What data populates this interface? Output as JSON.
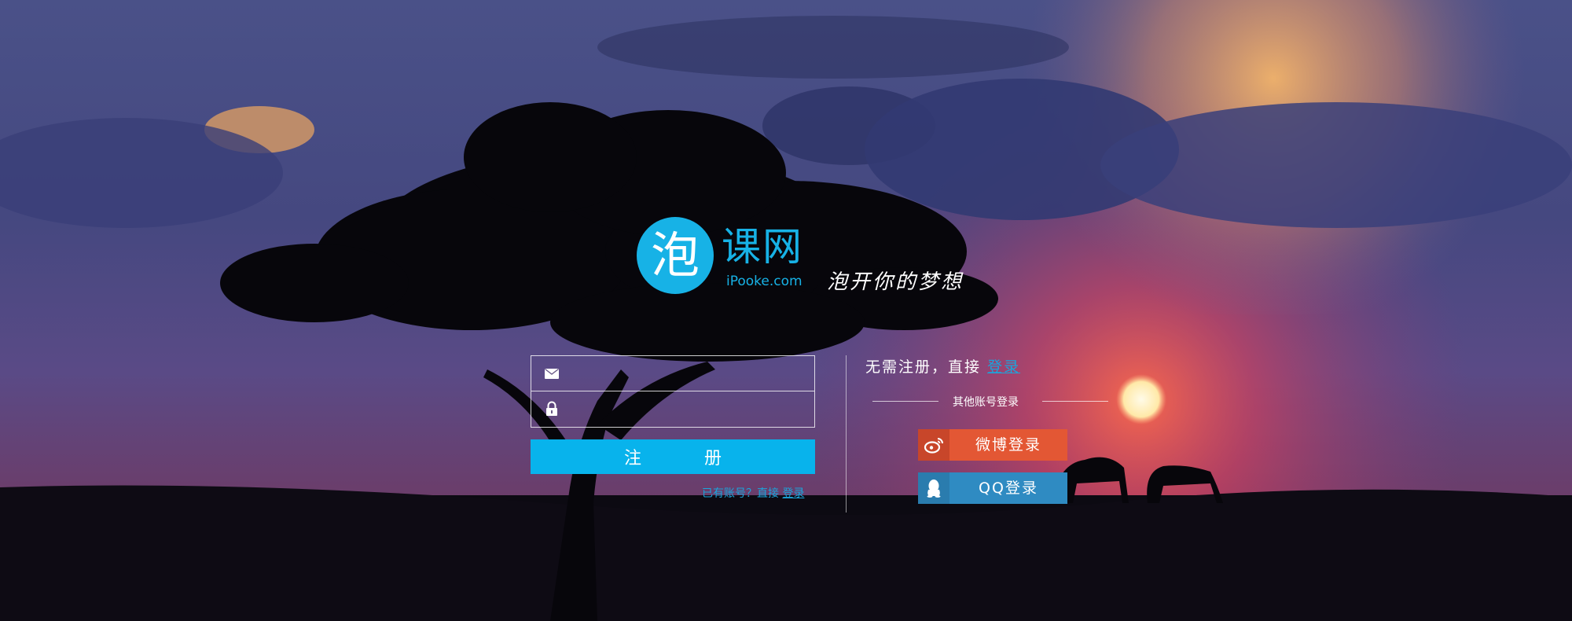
{
  "brand": {
    "logo_char": "泡",
    "name": "课网",
    "domain": "iPooke.com",
    "slogan": "泡开你的梦想",
    "accent_color": "#17b2e6"
  },
  "register_form": {
    "email_icon": "envelope-icon",
    "email_placeholder": "",
    "password_icon": "lock-icon",
    "password_placeholder": "",
    "submit_label": "注册",
    "have_account_text": "已有账号？直接",
    "login_link": "登录"
  },
  "quick_login": {
    "prompt": "无需注册，直接",
    "login_link": "登录",
    "other_accounts_label": "其他账号登录",
    "buttons": [
      {
        "icon": "weibo-icon",
        "label": "微博登录",
        "color": "#e35734"
      },
      {
        "icon": "qq-icon",
        "label": "QQ登录",
        "color": "#2f8bc2"
      }
    ]
  },
  "background": {
    "scene": "sunset-savanna",
    "sky_color": "#3a3a6e",
    "sun_color": "#ffe9b0",
    "ground_color": "#0c0a12"
  }
}
